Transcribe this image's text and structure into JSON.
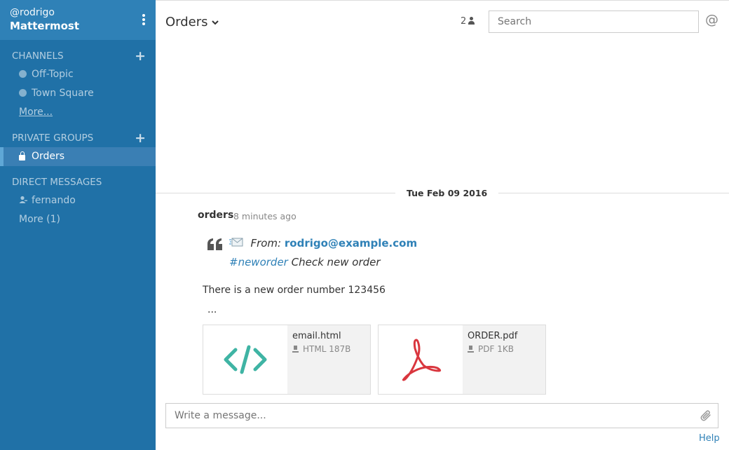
{
  "sidebar": {
    "username": "@rodrigo",
    "team_name": "Mattermost",
    "channels_title": "CHANNELS",
    "channels": [
      {
        "label": "Off-Topic"
      },
      {
        "label": "Town Square"
      }
    ],
    "channels_more": "More...",
    "private_title": "PRIVATE GROUPS",
    "private_groups": [
      {
        "label": "Orders"
      }
    ],
    "dm_title": "DIRECT MESSAGES",
    "direct_messages": [
      {
        "label": "fernando"
      }
    ],
    "dm_more": "More (1)",
    "plus": "+",
    "colors": {
      "background": "#2071a7",
      "header": "#2f81b7",
      "active": "#3a7fb4"
    }
  },
  "header": {
    "channel_name": "Orders",
    "caret": "⌄",
    "member_count": "2",
    "search_placeholder": "Search",
    "at_symbol": "@"
  },
  "post": {
    "date_separator": "Tue Feb 09 2016",
    "username": "orders",
    "time": "8 minutes ago",
    "quote_mark": "❝",
    "mail_emoji": "📨",
    "from_label": "From:",
    "from_email": "rodrigo@example.com",
    "hashtag": "#neworder",
    "subject": "Check new order",
    "body": "There is a new order number 123456",
    "ellipsis": "...",
    "attachments": [
      {
        "name": "email.html",
        "meta": "HTML 187B",
        "icon": "code-file-icon"
      },
      {
        "name": "ORDER.pdf",
        "meta": "PDF 1KB",
        "icon": "pdf-file-icon"
      }
    ]
  },
  "composer": {
    "placeholder": "Write a message...",
    "help": "Help"
  },
  "accent_color": "#2f81b7"
}
